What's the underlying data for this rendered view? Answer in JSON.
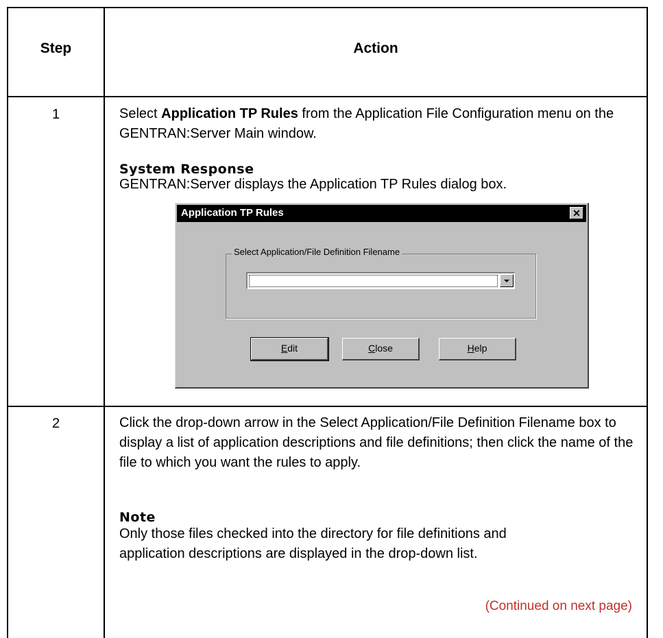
{
  "table": {
    "header": {
      "step": "Step",
      "action": "Action"
    },
    "rows": [
      {
        "step": "1",
        "action_pre": "Select ",
        "action_bold": "Application TP Rules",
        "action_post": " from the Application File Configuration menu on the GENTRAN:Server Main window.",
        "subhead": "System Response",
        "response": "GENTRAN:Server displays the Application TP Rules dialog box."
      },
      {
        "step": "2",
        "action": "Click the drop-down arrow in the Select Application/File Definition Filename box to display a list of application descriptions and file definitions; then click the name of the file to which you want the rules to apply.",
        "subhead": "Note",
        "note": "Only those files checked into the directory for file definitions and application descriptions are displayed in the drop-down list.",
        "continued": "(Continued on next page)"
      }
    ]
  },
  "dialog": {
    "title": "Application TP Rules",
    "close_glyph": "✕",
    "group_label": "Select Application/File Definition Filename",
    "combo_value": "",
    "buttons": [
      {
        "mnemonic": "E",
        "rest": "dit"
      },
      {
        "mnemonic": "C",
        "rest": "lose"
      },
      {
        "mnemonic": "H",
        "rest": "elp"
      }
    ]
  }
}
